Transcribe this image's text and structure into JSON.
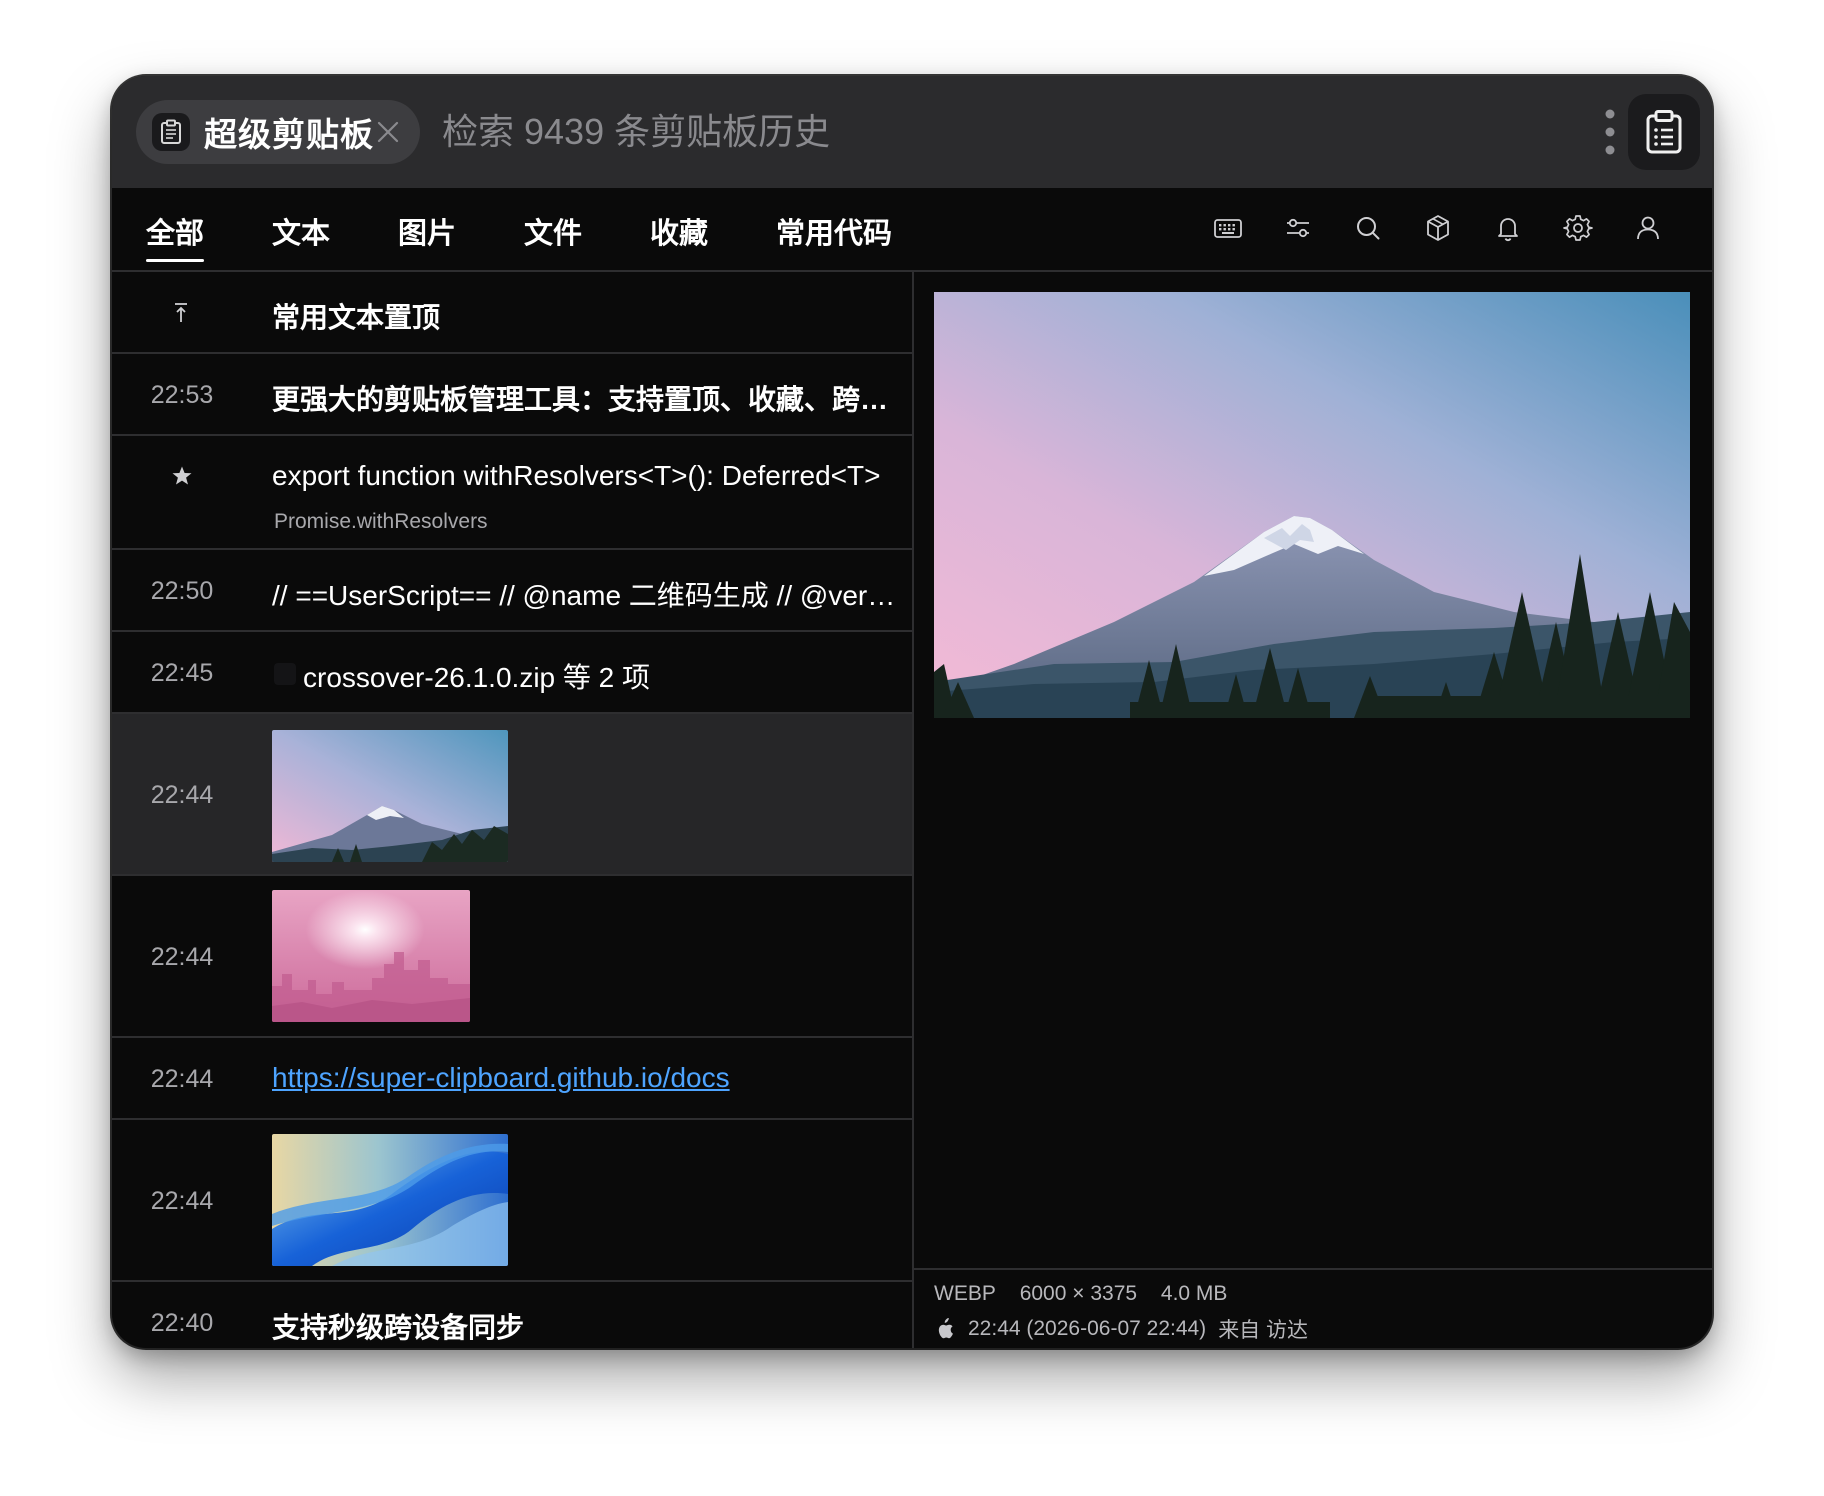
{
  "app": {
    "name": "超级剪贴板",
    "search_placeholder": "检索 9439 条剪贴板历史"
  },
  "tabs": [
    {
      "label": "全部",
      "active": true
    },
    {
      "label": "文本"
    },
    {
      "label": "图片"
    },
    {
      "label": "文件"
    },
    {
      "label": "收藏"
    },
    {
      "label": "常用代码"
    }
  ],
  "toolbar_icons": [
    "keyboard-icon",
    "sliders-icon",
    "search-icon",
    "cube-icon",
    "bell-icon",
    "gear-icon",
    "user-icon"
  ],
  "items": [
    {
      "marker": "pin-icon",
      "text": "常用文本置顶"
    },
    {
      "time": "22:53",
      "text": "更强大的剪贴板管理工具：支持置顶、收藏、跨设备同步"
    },
    {
      "marker": "star-icon",
      "text": "export function withResolvers<T>(): Deferred<T>",
      "subtitle": "Promise.withResolvers"
    },
    {
      "time": "22:50",
      "text": "// ==UserScript== // @name 二维码生成 // @version"
    },
    {
      "time": "22:45",
      "text": "crossover-26.1.0.zip 等 2 项"
    },
    {
      "time": "22:44",
      "image": "mountain-thumbnail",
      "selected": true
    },
    {
      "time": "22:44",
      "image": "pink-city-thumbnail"
    },
    {
      "time": "22:44",
      "link": "https://super-clipboard.github.io/docs"
    },
    {
      "time": "22:44",
      "image": "blue-wave-thumbnail"
    },
    {
      "time": "22:40",
      "text": "支持秒级跨设备同步"
    }
  ],
  "preview": {
    "format": "WEBP",
    "dimensions": "6000 × 3375",
    "size": "4.0 MB",
    "timestamp": "22:44 (2026-06-07 22:44)",
    "source": "来自 访达",
    "source_icon": "apple-icon"
  },
  "colors": {
    "link": "#4ea4ff",
    "window_bg": "#0a0a0a",
    "titlebar_bg": "#2b2b2d"
  }
}
